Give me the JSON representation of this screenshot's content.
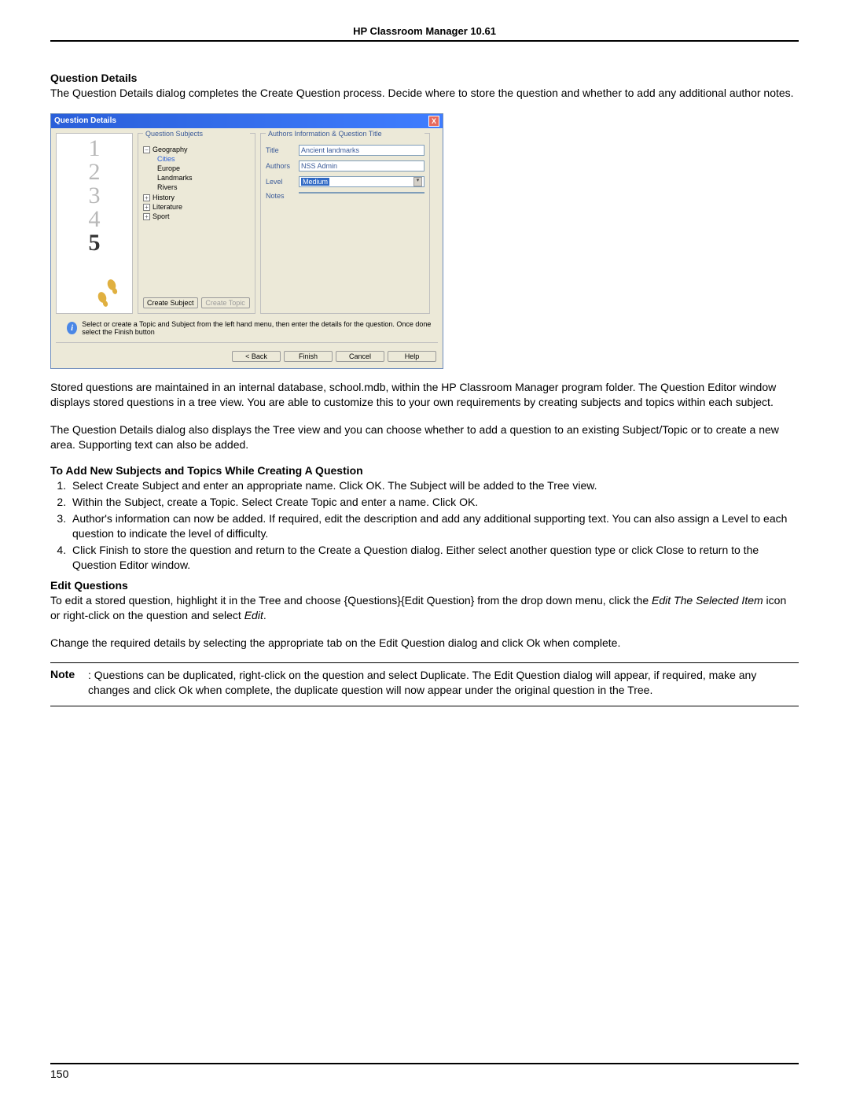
{
  "header": "HP Classroom Manager 10.61",
  "page_number": "150",
  "section1": {
    "heading": "Question Details",
    "para": "The Question Details dialog completes the Create Question process. Decide where to store the question and whether to add any additional author notes."
  },
  "dialog": {
    "title": "Question Details",
    "close_icon_alt": "X",
    "graphic_nums": [
      "1",
      "2",
      "3",
      "4"
    ],
    "graphic_num5": "5",
    "subjects": {
      "panel_title": "Question Subjects",
      "tree": {
        "root_exp": "−",
        "root": "Geography",
        "children": [
          "Cities",
          "Europe",
          "Landmarks",
          "Rivers"
        ],
        "others": [
          {
            "exp": "+",
            "label": "History"
          },
          {
            "exp": "+",
            "label": "Literature"
          },
          {
            "exp": "+",
            "label": "Sport"
          }
        ]
      },
      "btn_create_subject": "Create Subject",
      "btn_create_topic": "Create Topic"
    },
    "authors": {
      "panel_title": "Authors Information & Question Title",
      "title_label": "Title",
      "title_value": "Ancient landmarks",
      "authors_label": "Authors",
      "authors_value": "NSS Admin",
      "level_label": "Level",
      "level_value": "Medium",
      "notes_label": "Notes"
    },
    "info_text": "Select or create a Topic and Subject from the left hand menu, then enter the details for the question. Once done select the Finish button",
    "buttons": {
      "back": "< Back",
      "finish": "Finish",
      "cancel": "Cancel",
      "help": "Help"
    }
  },
  "para2": "Stored questions are maintained in an internal database, school.mdb, within the HP Classroom Manager program folder. The Question Editor window displays stored questions in a tree view. You are able to customize this to your own requirements by creating subjects and topics within each subject.",
  "para3": "The Question Details dialog also displays the Tree view and you can choose whether to add a question to an existing Subject/Topic or to create a new area. Supporting text can also be added.",
  "section2": {
    "heading": "To Add New Subjects and Topics While Creating A Question",
    "items": [
      "Select Create Subject and enter an appropriate name. Click OK. The Subject will be added to the Tree view.",
      "Within the Subject, create a Topic. Select Create Topic and enter a name. Click OK.",
      "Author's information can now be added. If required, edit the description and add any additional supporting text. You can also assign a Level to each question to indicate the level of difficulty.",
      "Click Finish to store the question and return to the Create a Question dialog. Either select another question type or click Close to return to the Question Editor window."
    ]
  },
  "section3": {
    "heading": "Edit Questions",
    "para_pre": "To edit a stored question, highlight it in the Tree and choose {Questions}{Edit Question} from the drop down menu, click the ",
    "para_em": "Edit The Selected Item",
    "para_mid": " icon or right-click on the question and select ",
    "para_em2": "Edit",
    "para_post": ".",
    "para2": "Change the required details by selecting the appropriate tab on the Edit Question dialog and click Ok when complete."
  },
  "note": {
    "label": "Note",
    "text": ": Questions can be duplicated, right-click on the question and select Duplicate. The Edit Question dialog will appear, if required, make any changes and click Ok when complete, the duplicate question will now appear under the original question in the Tree."
  }
}
